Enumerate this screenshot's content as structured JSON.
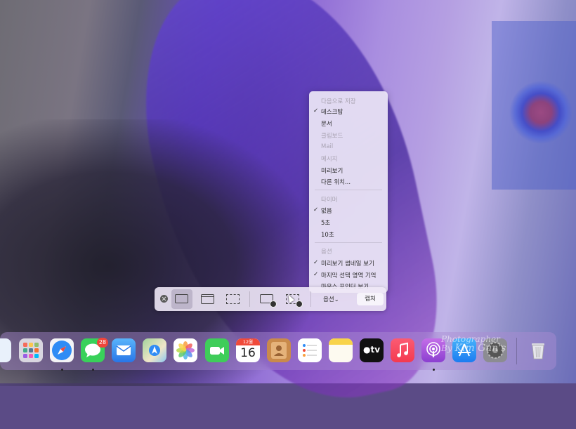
{
  "options_menu": {
    "save_to_header": "다음으로 저장",
    "save_to_items": [
      {
        "label": "데스크탑",
        "checked": true,
        "enabled": true
      },
      {
        "label": "문서",
        "checked": false,
        "enabled": true
      },
      {
        "label": "클립보드",
        "checked": false,
        "enabled": false
      },
      {
        "label": "Mail",
        "checked": false,
        "enabled": false
      },
      {
        "label": "메시지",
        "checked": false,
        "enabled": false
      },
      {
        "label": "미리보기",
        "checked": false,
        "enabled": true
      },
      {
        "label": "다른 위치...",
        "checked": false,
        "enabled": true
      }
    ],
    "timer_header": "타이머",
    "timer_items": [
      {
        "label": "없음",
        "checked": true
      },
      {
        "label": "5초",
        "checked": false
      },
      {
        "label": "10초",
        "checked": false
      }
    ],
    "options_header": "옵션",
    "options_items": [
      {
        "label": "미리보기 썸네일 보기",
        "checked": true
      },
      {
        "label": "마지막 선택 영역 기억",
        "checked": true
      },
      {
        "label": "마우스 포인터 보기",
        "checked": false
      }
    ]
  },
  "toolbar": {
    "options_label": "옵션",
    "options_chevron": "⌄",
    "capture_label": "캡처",
    "selected_mode": "capture-entire-screen"
  },
  "dock": {
    "messages_badge": "28",
    "calendar": {
      "month": "12월",
      "day": "16"
    },
    "tv_label": "tv"
  },
  "watermark": {
    "line1": "Photographer",
    "line2": "By",
    "name": "Kim Gun's"
  },
  "colors": {
    "accent_red": "#f0453a",
    "menu_bg": "#ece6f6"
  }
}
